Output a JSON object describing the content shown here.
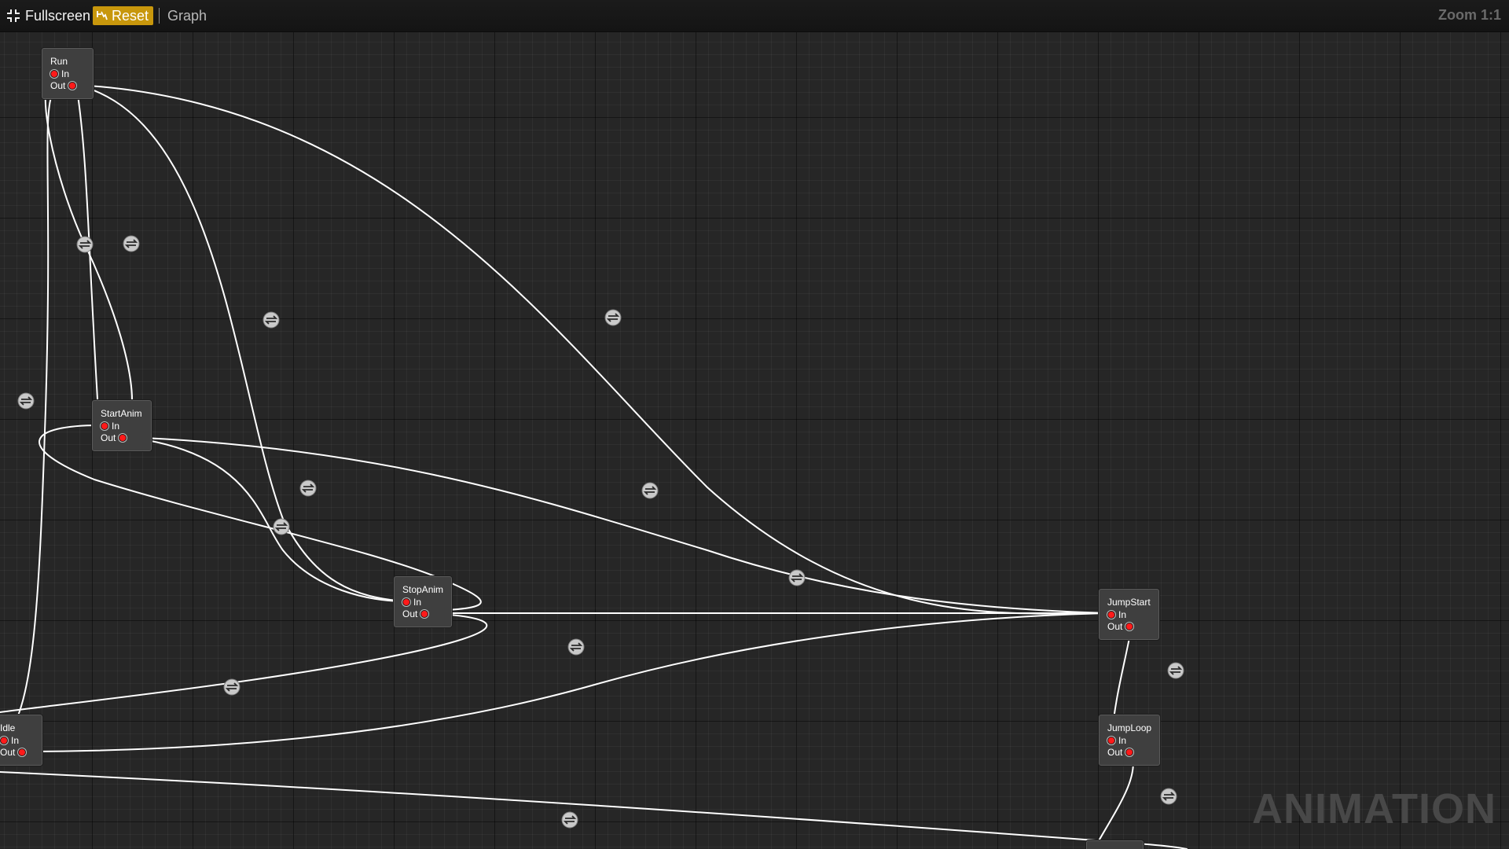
{
  "toolbar": {
    "fullscreen_label": "Fullscreen",
    "fullscreen_icon": "fullscreen-icon",
    "reset_label": "Reset",
    "reset_icon": "reset-icon",
    "tab_label": "Graph",
    "zoom_label": "Zoom 1:1"
  },
  "watermark": "ANIMATION",
  "colors": {
    "background": "#262626",
    "toolbar": "#161616",
    "reset_button": "#c8970c",
    "node_fill": "#3f3f3f",
    "pin": "#ff1a1a",
    "wire": "#ffffff",
    "transition_icon": "#c9c9c9"
  },
  "nodes": [
    {
      "id": "run",
      "title": "Run",
      "in_label": "In",
      "out_label": "Out"
    },
    {
      "id": "startanim",
      "title": "StartAnim",
      "in_label": "In",
      "out_label": "Out"
    },
    {
      "id": "stopanim",
      "title": "StopAnim",
      "in_label": "In",
      "out_label": "Out"
    },
    {
      "id": "jumpstart",
      "title": "JumpStart",
      "in_label": "In",
      "out_label": "Out"
    },
    {
      "id": "idle",
      "title": "Idle",
      "in_label": "In",
      "out_label": "Out"
    },
    {
      "id": "jumploop",
      "title": "JumpLoop",
      "in_label": "In",
      "out_label": "Out"
    }
  ],
  "transitions": [
    {
      "icon": "transition-icon"
    }
  ]
}
